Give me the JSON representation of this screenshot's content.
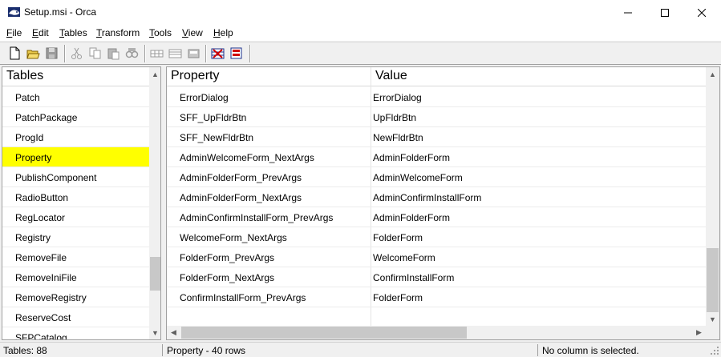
{
  "window": {
    "title": "Setup.msi - Orca",
    "minimize_glyph": "—",
    "maximize_glyph": "☐",
    "close_glyph": "✕"
  },
  "menu": [
    {
      "label": "File",
      "hotkey_index": 0
    },
    {
      "label": "Edit",
      "hotkey_index": 0
    },
    {
      "label": "Tables",
      "hotkey_index": 0
    },
    {
      "label": "Transform",
      "hotkey_index": 0
    },
    {
      "label": "Tools",
      "hotkey_index": 0
    },
    {
      "label": "View",
      "hotkey_index": 0
    },
    {
      "label": "Help",
      "hotkey_index": 0
    }
  ],
  "toolbar": {
    "buttons": [
      "new-file-icon",
      "open-folder-icon",
      "save-icon",
      "cut-icon",
      "copy-icon",
      "paste-icon",
      "find-icon",
      "add-row-icon",
      "drop-row-icon",
      "table-properties-icon",
      "validate-icon",
      "merge-module-icon"
    ]
  },
  "tables_pane": {
    "header": "Tables",
    "items": [
      {
        "label": "Patch",
        "selected": false
      },
      {
        "label": "PatchPackage",
        "selected": false
      },
      {
        "label": "ProgId",
        "selected": false
      },
      {
        "label": "Property",
        "selected": true
      },
      {
        "label": "PublishComponent",
        "selected": false
      },
      {
        "label": "RadioButton",
        "selected": false
      },
      {
        "label": "RegLocator",
        "selected": false
      },
      {
        "label": "Registry",
        "selected": false
      },
      {
        "label": "RemoveFile",
        "selected": false
      },
      {
        "label": "RemoveIniFile",
        "selected": false
      },
      {
        "label": "RemoveRegistry",
        "selected": false
      },
      {
        "label": "ReserveCost",
        "selected": false
      },
      {
        "label": "SFPCatalog",
        "selected": false
      }
    ],
    "selected_color": "#ffff00"
  },
  "grid": {
    "columns": [
      "Property",
      "Value"
    ],
    "rows": [
      {
        "property": "ErrorDialog",
        "value": "ErrorDialog"
      },
      {
        "property": "SFF_UpFldrBtn",
        "value": "UpFldrBtn"
      },
      {
        "property": "SFF_NewFldrBtn",
        "value": "NewFldrBtn"
      },
      {
        "property": "AdminWelcomeForm_NextArgs",
        "value": "AdminFolderForm"
      },
      {
        "property": "AdminFolderForm_PrevArgs",
        "value": "AdminWelcomeForm"
      },
      {
        "property": "AdminFolderForm_NextArgs",
        "value": "AdminConfirmInstallForm"
      },
      {
        "property": "AdminConfirmInstallForm_PrevArgs",
        "value": "AdminFolderForm"
      },
      {
        "property": "WelcomeForm_NextArgs",
        "value": "FolderForm"
      },
      {
        "property": "FolderForm_PrevArgs",
        "value": "WelcomeForm"
      },
      {
        "property": "FolderForm_NextArgs",
        "value": "ConfirmInstallForm"
      },
      {
        "property": "ConfirmInstallForm_PrevArgs",
        "value": "FolderForm"
      }
    ]
  },
  "status": {
    "tables_count": "Tables: 88",
    "rows_info": "Property - 40 rows",
    "column_info": "No column is selected."
  }
}
